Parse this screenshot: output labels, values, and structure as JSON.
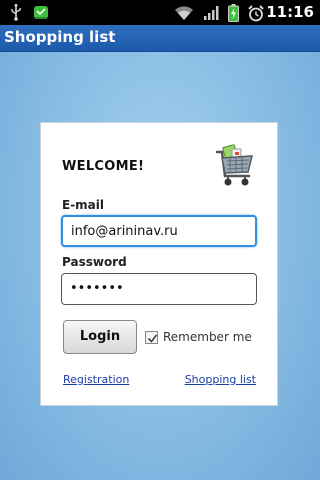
{
  "status_bar": {
    "time": "11:16",
    "icons": [
      "usb-icon",
      "android-robot-icon",
      "wifi-icon",
      "signal-icon",
      "battery-charging-icon",
      "alarm-icon"
    ]
  },
  "app": {
    "title": "Shopping list"
  },
  "login": {
    "welcome": "WELCOME!",
    "email_label": "E-mail",
    "email_value": "info@arininav.ru",
    "password_label": "Password",
    "password_value": "•••••••",
    "login_button": "Login",
    "remember_label": "Remember me",
    "remember_checked": true,
    "registration_link": "Registration",
    "shopping_list_link": "Shopping list"
  },
  "colors": {
    "title_bar": "#1f5fb1",
    "focus_border": "#2f8fe0",
    "link": "#1a3ea8",
    "background": "#8cc0e6"
  }
}
